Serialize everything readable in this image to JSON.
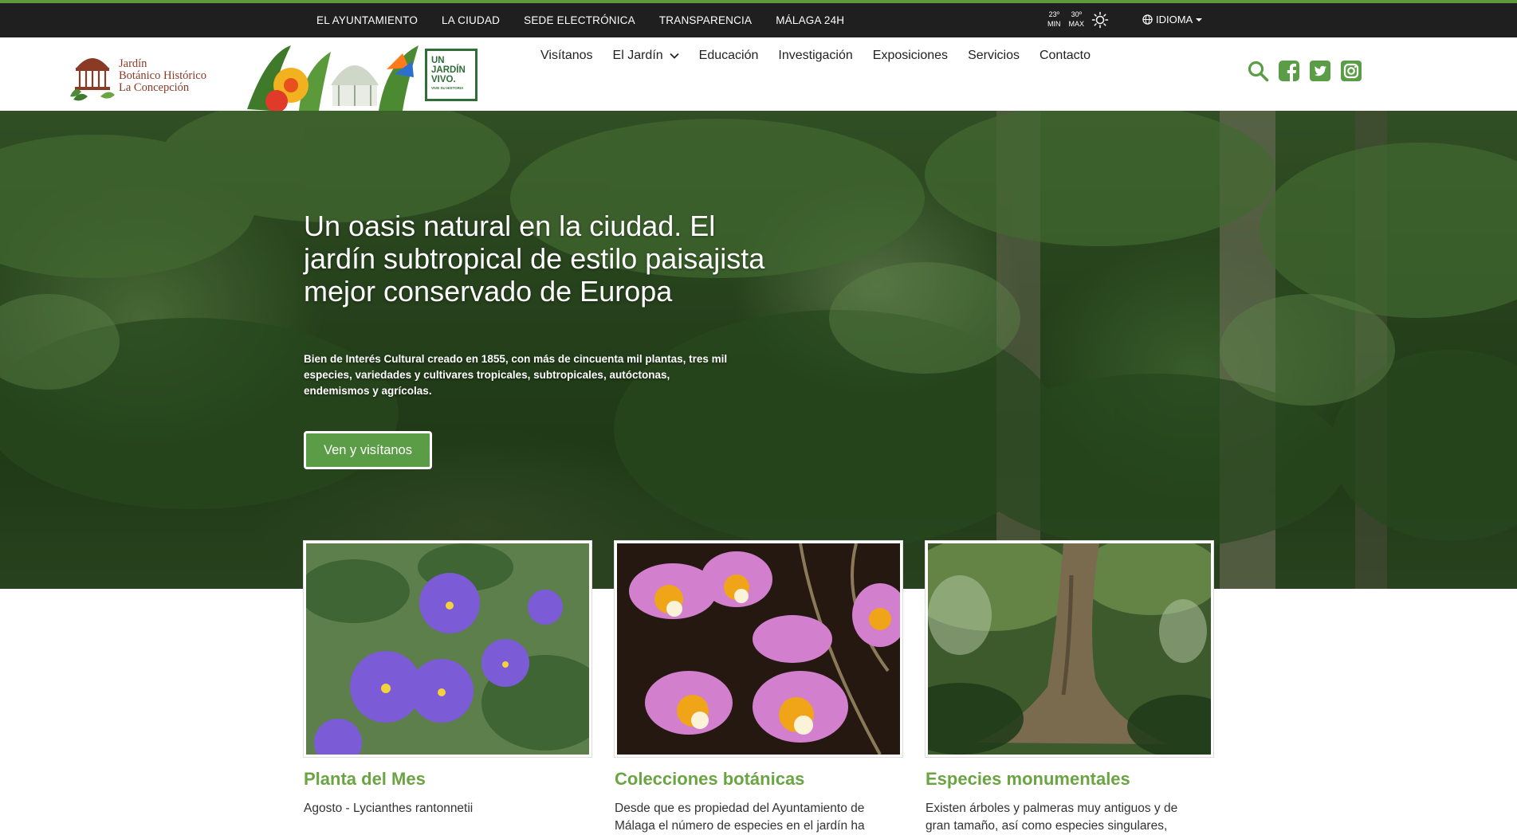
{
  "topbar": {
    "links": [
      "EL AYUNTAMIENTO",
      "LA CIUDAD",
      "SEDE ELECTRÓNICA",
      "TRANSPARENCIA",
      "MÁLAGA 24H"
    ],
    "weather": {
      "min_value": "23º",
      "min_label": "MIN",
      "max_value": "30º",
      "max_label": "MAX",
      "icon": "sun-icon"
    },
    "language_label": "IDIOMA"
  },
  "header": {
    "logo_lines": [
      "Jardín",
      "Botánico Histórico",
      "La Concepción"
    ],
    "promo_lines": [
      "UN",
      "JARDÍN",
      "VIVO."
    ],
    "promo_tagline": "VIVE SU HISTORIA",
    "nav": [
      "Visítanos",
      "El Jardín",
      "Educación",
      "Investigación",
      "Exposiciones",
      "Servicios",
      "Contacto"
    ],
    "social_icons": [
      "search-icon",
      "facebook-icon",
      "twitter-icon",
      "instagram-icon"
    ]
  },
  "hero": {
    "title": "Un oasis natural en la ciudad. El jardín subtropical de estilo paisajista mejor conservado de Europa",
    "subtitle": "Bien de Interés Cultural creado en 1855, con más de cincuenta mil plantas, tres mil especies, variedades y cultivares tropicales, subtropicales, autóctonas, endemismos y agrícolas.",
    "button": "Ven y visítanos"
  },
  "cards": [
    {
      "title": "Planta del Mes",
      "text": "Agosto - Lycianthes rantonnetii"
    },
    {
      "title": "Colecciones botánicas",
      "text": "Desde que es propiedad del Ayuntamiento de Málaga el número de especies en el jardín ha"
    },
    {
      "title": "Especies monumentales",
      "text": "Existen árboles y palmeras muy antiguos y de gran tamaño, así como especies singulares,"
    }
  ],
  "colors": {
    "accent": "#5e9a3d",
    "heading_green": "#6aa443",
    "topbar": "#1f1f1f",
    "promo_green": "#2f6e37",
    "logo_red": "#8b3a26"
  }
}
